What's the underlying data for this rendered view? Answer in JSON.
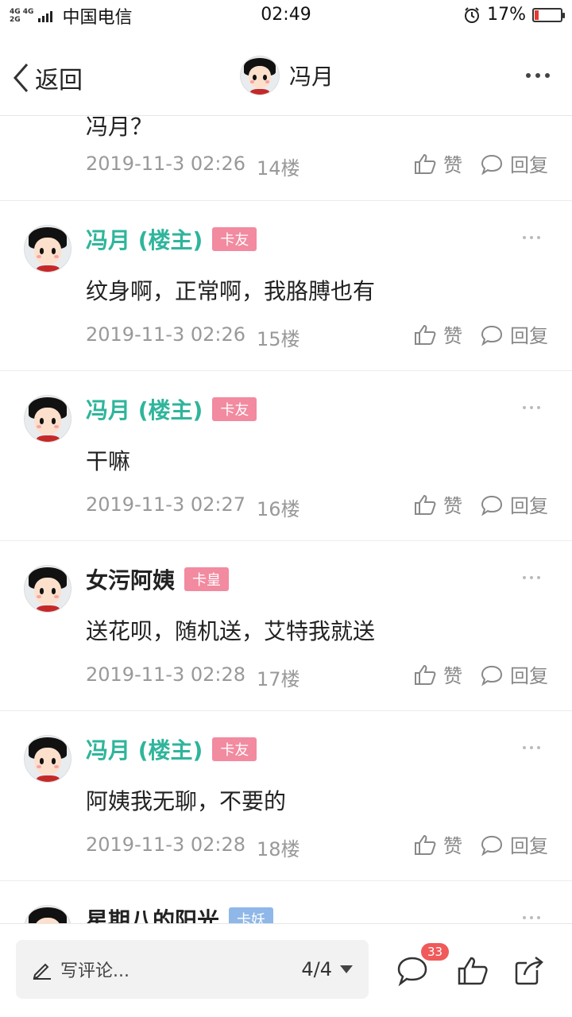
{
  "status_bar": {
    "network_top": "4G 4G",
    "network_bottom": "2G",
    "carrier": "中国电信",
    "time": "02:49",
    "battery_pct": "17%",
    "battery_level": 0.17
  },
  "nav": {
    "back_label": "返回",
    "title": "冯月"
  },
  "partial_post": {
    "text": "冯月？",
    "date": "2019-11-3 02:26",
    "floor": "14楼",
    "like": "赞",
    "reply": "回复"
  },
  "posts": [
    {
      "author": "冯月 (楼主)",
      "badge": "卡友",
      "text": "纹身啊，正常啊，我胳膊也有",
      "date": "2019-11-3 02:26",
      "floor": "15楼",
      "like": "赞",
      "reply": "回复"
    },
    {
      "author": "冯月 (楼主)",
      "badge": "卡友",
      "text": "干嘛",
      "date": "2019-11-3 02:27",
      "floor": "16楼",
      "like": "赞",
      "reply": "回复"
    },
    {
      "author": "女污阿姨",
      "badge": "卡皇",
      "text": "送花呗，随机送，艾特我就送",
      "date": "2019-11-3 02:28",
      "floor": "17楼",
      "like": "赞",
      "reply": "回复"
    },
    {
      "author": "冯月 (楼主)",
      "badge": "卡友",
      "text": "阿姨我无聊，不要的",
      "date": "2019-11-3 02:28",
      "floor": "18楼",
      "like": "赞",
      "reply": "回复"
    },
    {
      "author": "星期八的阳光",
      "badge": "卡妖"
    }
  ],
  "bottom_bar": {
    "comment_placeholder": "写评论...",
    "page_indicator": "4/4",
    "comment_count": "33"
  },
  "colors": {
    "op_author": "#2fb59b",
    "badge_pink": "#f28aa0",
    "badge_blue": "#8fb7e8",
    "count_badge": "#f05a5a"
  }
}
